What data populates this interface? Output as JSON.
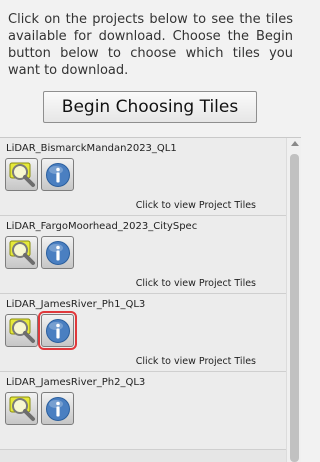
{
  "intro_text": "Click on the projects below to see the tiles available for download. Choose the Begin button below to choose which tiles you want to download.",
  "begin_button": "Begin Choosing Tiles",
  "view_tiles_text": "Click to view Project Tiles",
  "projects": [
    {
      "name": "LiDAR_BismarckMandan2023_QL1"
    },
    {
      "name": "LiDAR_FargoMoorhead_2023_CitySpec"
    },
    {
      "name": "LiDAR_JamesRiver_Ph1_QL3"
    },
    {
      "name": "LiDAR_JamesRiver_Ph2_QL3"
    }
  ],
  "icons": {
    "zoom": "magnifier-zoom-icon",
    "info": "info-icon"
  },
  "colors": {
    "highlight": "#e0383b",
    "info_blue": "#4a7fc1"
  }
}
